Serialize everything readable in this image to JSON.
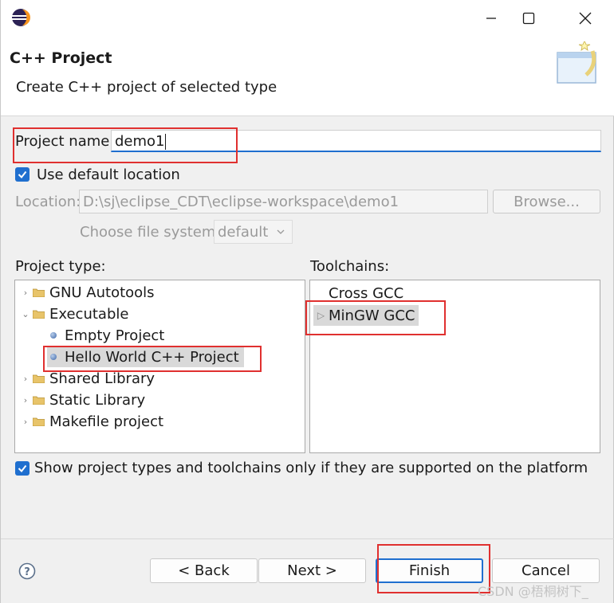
{
  "window": {
    "title_icon": "eclipse-icon",
    "minimize_icon": "minimize-icon",
    "maximize_icon": "maximize-icon",
    "close_icon": "close-icon"
  },
  "banner": {
    "title": "C++ Project",
    "description": "Create C++ project of selected type"
  },
  "form": {
    "project_name_label": "Project name:",
    "project_name_value": "demo1",
    "use_default_location_label": "Use default location",
    "use_default_location_checked": true,
    "location_label": "Location:",
    "location_value": "D:\\sj\\eclipse_CDT\\eclipse-workspace\\demo1",
    "browse_label": "Browse...",
    "file_system_label": "Choose file system:",
    "file_system_value": "default"
  },
  "project_type": {
    "label": "Project type:",
    "items": [
      {
        "label": "GNU Autotools",
        "kind": "folder",
        "expanded": false
      },
      {
        "label": "Executable",
        "kind": "folder",
        "expanded": true
      },
      {
        "label": "Empty Project",
        "kind": "leaf"
      },
      {
        "label": "Hello World C++ Project",
        "kind": "leaf",
        "selected": true
      },
      {
        "label": "Shared Library",
        "kind": "folder",
        "expanded": false
      },
      {
        "label": "Static Library",
        "kind": "folder",
        "expanded": false
      },
      {
        "label": "Makefile project",
        "kind": "folder",
        "expanded": false
      }
    ]
  },
  "toolchains": {
    "label": "Toolchains:",
    "items": [
      {
        "label": "Cross GCC",
        "selected": false
      },
      {
        "label": "MinGW GCC",
        "selected": true
      }
    ]
  },
  "filter": {
    "label": "Show project types and toolchains only if they are supported on the platform",
    "checked": true
  },
  "buttons": {
    "help_icon": "help-icon",
    "back": "< Back",
    "next": "Next >",
    "finish": "Finish",
    "cancel": "Cancel"
  },
  "watermark": "CSDN @梧桐树下_",
  "colors": {
    "accent": "#1f6fcf",
    "highlight_box": "#e0302f",
    "selection": "#d9d9d9"
  }
}
